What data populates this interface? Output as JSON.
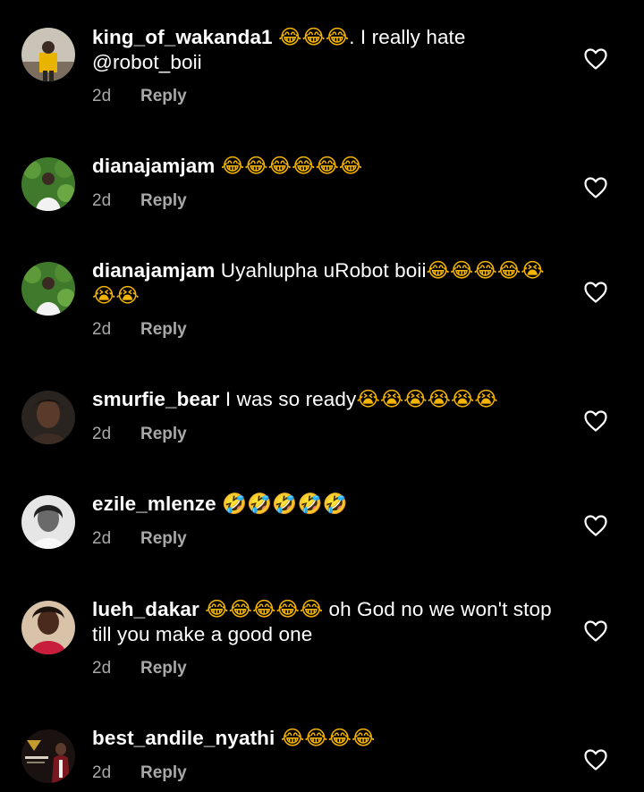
{
  "comments": [
    {
      "username": "king_of_wakanda1",
      "emoji_before": "😂😂😂",
      "text": ". I really hate @robot_boii",
      "emoji_after": "",
      "time": "2d",
      "reply_label": "Reply",
      "avatar_icon": "person-avatar-yellow-shirt"
    },
    {
      "username": "dianajamjam",
      "emoji_before": "😂😂😂😂😂😂",
      "text": "",
      "emoji_after": "",
      "time": "2d",
      "reply_label": "Reply",
      "avatar_icon": "person-avatar-green-leaves"
    },
    {
      "username": "dianajamjam",
      "emoji_before": "",
      "text": "Uyahlupha uRobot boii",
      "emoji_after": "😂😂😂😂😭😭😭",
      "time": "2d",
      "reply_label": "Reply",
      "avatar_icon": "person-avatar-green-leaves"
    },
    {
      "username": "smurfie_bear",
      "emoji_before": "",
      "text": "I was so ready",
      "emoji_after": "😭😭😭😭😭😭",
      "time": "2d",
      "reply_label": "Reply",
      "avatar_icon": "person-avatar-dark"
    },
    {
      "username": "ezile_mlenze",
      "emoji_before": "🤣🤣🤣🤣🤣",
      "text": "",
      "emoji_after": "",
      "time": "2d",
      "reply_label": "Reply",
      "avatar_icon": "person-avatar-grayscale"
    },
    {
      "username": "lueh_dakar",
      "emoji_before": "😂😂😂😂😂",
      "text": "oh God no we won't stop till you make a good one",
      "emoji_after": "",
      "time": "2d",
      "reply_label": "Reply",
      "avatar_icon": "person-avatar-red-top"
    },
    {
      "username": "best_andile_nyathi",
      "emoji_before": "😂😂😂😂",
      "text": "",
      "emoji_after": "",
      "time": "2d",
      "reply_label": "Reply",
      "avatar_icon": "person-avatar-poster"
    }
  ],
  "icons": {
    "like": "heart-outline-icon"
  },
  "colors": {
    "background": "#000000",
    "text": "#ffffff",
    "meta": "#a8a8a8",
    "emoji": "#f4b400"
  }
}
